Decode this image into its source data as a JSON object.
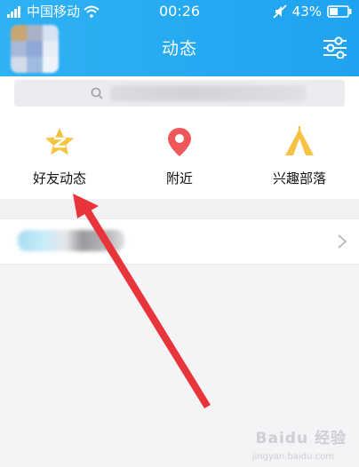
{
  "status_bar": {
    "carrier": "中国移动",
    "time": "00:26",
    "battery": "43%"
  },
  "header": {
    "title": "动态",
    "settings_icon": "sliders-icon",
    "accent_color": "#25a9f2"
  },
  "search": {
    "icon": "search-icon"
  },
  "quick_items": [
    {
      "label": "好友动态",
      "icon": "qzone-star-icon",
      "color": "#f5c242"
    },
    {
      "label": "附近",
      "icon": "location-pin-icon",
      "color": "#f0575a"
    },
    {
      "label": "兴趣部落",
      "icon": "tent-icon",
      "color": "#f6c243"
    }
  ],
  "watermark": {
    "text": "Baidu 经验",
    "sub": "jingyan.baidu.com"
  }
}
